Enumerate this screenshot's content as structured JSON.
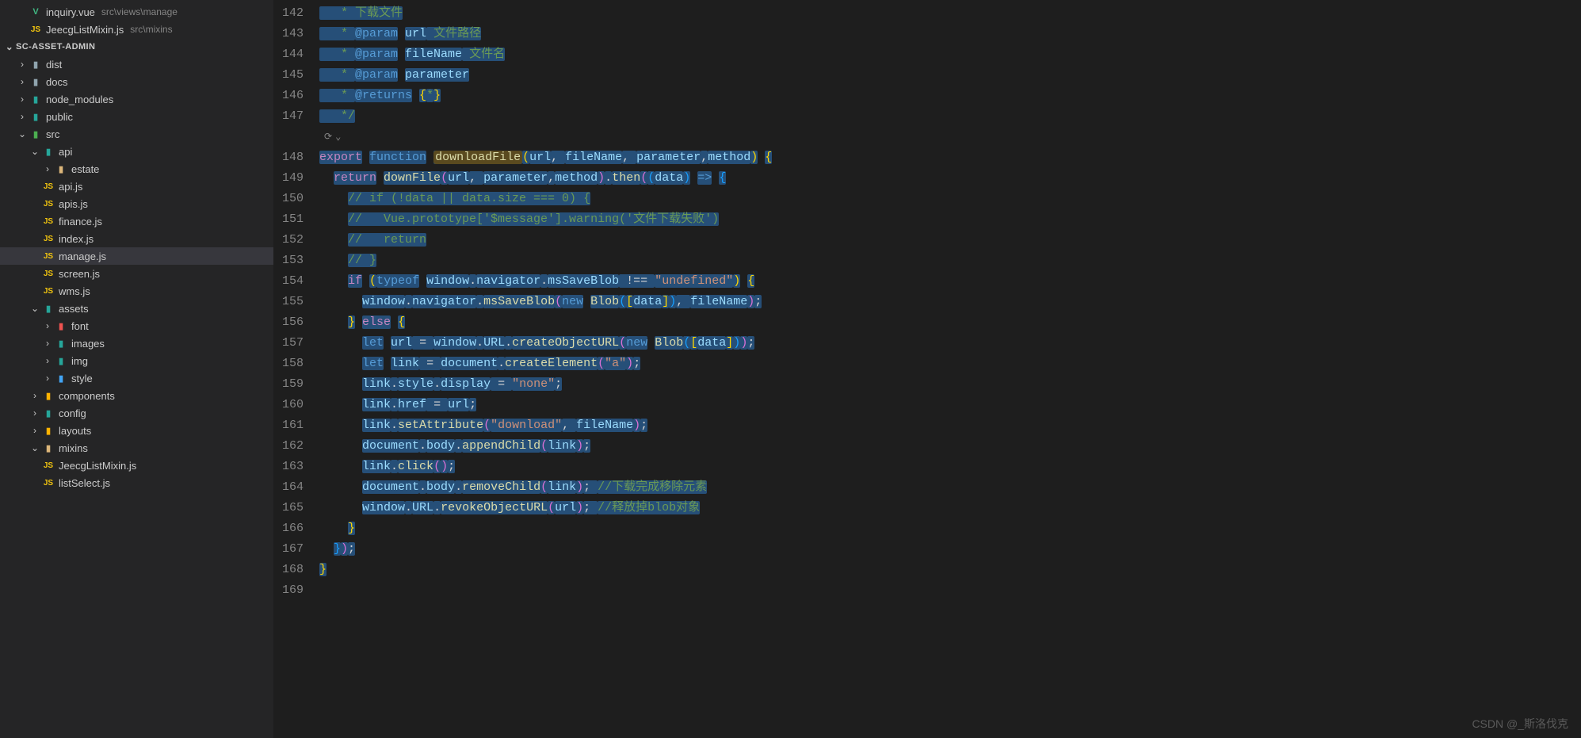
{
  "openEditors": [
    {
      "icon": "V",
      "iconClass": "icon-vue",
      "name": "inquiry.vue",
      "path": "src\\views\\manage"
    },
    {
      "icon": "JS",
      "iconClass": "icon-js",
      "name": "JeecgListMixin.js",
      "path": "src\\mixins"
    }
  ],
  "project": {
    "name": "SC-ASSET-ADMIN"
  },
  "tree": {
    "dist": "dist",
    "docs": "docs",
    "node_modules": "node_modules",
    "public": "public",
    "src": "src",
    "api": "api",
    "estate": "estate",
    "api_js": "api.js",
    "apis_js": "apis.js",
    "finance_js": "finance.js",
    "index_js": "index.js",
    "manage_js": "manage.js",
    "screen_js": "screen.js",
    "wms_js": "wms.js",
    "assets": "assets",
    "font": "font",
    "images": "images",
    "img": "img",
    "style": "style",
    "components": "components",
    "config": "config",
    "layouts": "layouts",
    "mixins": "mixins",
    "jeecg": "JeecgListMixin.js",
    "listSelect": "listSelect.js"
  },
  "codeLines": [
    {
      "num": "142",
      "code": [
        [
          "tok-cmt",
          "   * 下载文件"
        ]
      ]
    },
    {
      "num": "143",
      "code": [
        [
          "tok-cmt",
          "   * "
        ],
        [
          "tok-kw2",
          "@param"
        ],
        [
          "tok-cmt",
          " "
        ],
        [
          "tok-var",
          "url"
        ],
        [
          "tok-cmt",
          " 文件路径"
        ]
      ]
    },
    {
      "num": "144",
      "code": [
        [
          "tok-cmt",
          "   * "
        ],
        [
          "tok-kw2",
          "@param"
        ],
        [
          "tok-cmt",
          " "
        ],
        [
          "tok-var",
          "fileName"
        ],
        [
          "tok-cmt",
          " 文件名"
        ]
      ]
    },
    {
      "num": "145",
      "code": [
        [
          "tok-cmt",
          "   * "
        ],
        [
          "tok-kw2",
          "@param"
        ],
        [
          "tok-cmt",
          " "
        ],
        [
          "tok-var",
          "parameter"
        ]
      ]
    },
    {
      "num": "146",
      "code": [
        [
          "tok-cmt",
          "   * "
        ],
        [
          "tok-kw2",
          "@returns"
        ],
        [
          "tok-cmt",
          " "
        ],
        [
          "tok-brc",
          "{"
        ],
        [
          "tok-cmt",
          "*"
        ],
        [
          "tok-brc",
          "}"
        ]
      ]
    },
    {
      "num": "147",
      "code": [
        [
          "tok-cmt",
          "   */"
        ]
      ]
    }
  ],
  "regionLine": "148",
  "codeLines2": [
    {
      "num": "148",
      "code": [
        [
          "tok-kw",
          "export"
        ],
        [
          "tok-p",
          " "
        ],
        [
          "tok-kw2",
          "function"
        ],
        [
          "tok-p",
          " "
        ],
        [
          "hl-fn",
          "downloadFile"
        ],
        [
          "tok-brc",
          "("
        ],
        [
          "tok-var",
          "url"
        ],
        [
          "tok-p",
          ", "
        ],
        [
          "tok-var",
          "fileName"
        ],
        [
          "tok-p",
          ", "
        ],
        [
          "tok-var",
          "parameter"
        ],
        [
          "tok-p",
          ","
        ],
        [
          "tok-var",
          "method"
        ],
        [
          "tok-brc",
          ")"
        ],
        [
          "tok-p",
          " "
        ],
        [
          "tok-brc",
          "{"
        ]
      ]
    },
    {
      "num": "149",
      "code": [
        [
          "tok-p",
          "  "
        ],
        [
          "tok-kw",
          "return"
        ],
        [
          "tok-p",
          " "
        ],
        [
          "tok-fn",
          "downFile"
        ],
        [
          "tok-brc2",
          "("
        ],
        [
          "tok-var",
          "url"
        ],
        [
          "tok-p",
          ", "
        ],
        [
          "tok-var",
          "parameter"
        ],
        [
          "tok-p",
          ","
        ],
        [
          "tok-var",
          "method"
        ],
        [
          "tok-brc2",
          ")"
        ],
        [
          "tok-p",
          "."
        ],
        [
          "tok-fn",
          "then"
        ],
        [
          "tok-brc2",
          "("
        ],
        [
          "tok-brc3",
          "("
        ],
        [
          "tok-var",
          "data"
        ],
        [
          "tok-brc3",
          ")"
        ],
        [
          "tok-p",
          " "
        ],
        [
          "tok-kw2",
          "=>"
        ],
        [
          "tok-p",
          " "
        ],
        [
          "tok-brc3",
          "{"
        ]
      ]
    },
    {
      "num": "150",
      "code": [
        [
          "tok-p",
          "    "
        ],
        [
          "tok-cmt",
          "// if (!data || data.size === 0) {"
        ]
      ]
    },
    {
      "num": "151",
      "code": [
        [
          "tok-p",
          "    "
        ],
        [
          "tok-cmt",
          "//   Vue.prototype['$message'].warning('文件下载失败')"
        ]
      ]
    },
    {
      "num": "152",
      "code": [
        [
          "tok-p",
          "    "
        ],
        [
          "tok-cmt",
          "//   return"
        ]
      ]
    },
    {
      "num": "153",
      "code": [
        [
          "tok-p",
          "    "
        ],
        [
          "tok-cmt",
          "// }"
        ]
      ]
    },
    {
      "num": "154",
      "code": [
        [
          "tok-p",
          "    "
        ],
        [
          "tok-kw",
          "if"
        ],
        [
          "tok-p",
          " "
        ],
        [
          "tok-brc",
          "("
        ],
        [
          "tok-kw2",
          "typeof"
        ],
        [
          "tok-p",
          " "
        ],
        [
          "tok-var",
          "window"
        ],
        [
          "tok-p",
          "."
        ],
        [
          "tok-var",
          "navigator"
        ],
        [
          "tok-p",
          "."
        ],
        [
          "tok-var",
          "msSaveBlob"
        ],
        [
          "tok-p",
          " !== "
        ],
        [
          "tok-str",
          "\"undefined\""
        ],
        [
          "tok-brc",
          ")"
        ],
        [
          "tok-p",
          " "
        ],
        [
          "tok-brc",
          "{"
        ]
      ]
    },
    {
      "num": "155",
      "code": [
        [
          "tok-p",
          "      "
        ],
        [
          "tok-var",
          "window"
        ],
        [
          "tok-p",
          "."
        ],
        [
          "tok-var",
          "navigator"
        ],
        [
          "tok-p",
          "."
        ],
        [
          "tok-fn",
          "msSaveBlob"
        ],
        [
          "tok-brc2",
          "("
        ],
        [
          "tok-kw2",
          "new"
        ],
        [
          "tok-p",
          " "
        ],
        [
          "tok-fn",
          "Blob"
        ],
        [
          "tok-brc3",
          "("
        ],
        [
          "tok-brc",
          "["
        ],
        [
          "tok-var",
          "data"
        ],
        [
          "tok-brc",
          "]"
        ],
        [
          "tok-brc3",
          ")"
        ],
        [
          "tok-p",
          ", "
        ],
        [
          "tok-var",
          "fileName"
        ],
        [
          "tok-brc2",
          ")"
        ],
        [
          "tok-p",
          ";"
        ]
      ]
    },
    {
      "num": "156",
      "code": [
        [
          "tok-p",
          "    "
        ],
        [
          "tok-brc",
          "}"
        ],
        [
          "tok-p",
          " "
        ],
        [
          "tok-kw",
          "else"
        ],
        [
          "tok-p",
          " "
        ],
        [
          "tok-brc",
          "{"
        ]
      ]
    },
    {
      "num": "157",
      "code": [
        [
          "tok-p",
          "      "
        ],
        [
          "tok-kw2",
          "let"
        ],
        [
          "tok-p",
          " "
        ],
        [
          "tok-var",
          "url"
        ],
        [
          "tok-p",
          " = "
        ],
        [
          "tok-var",
          "window"
        ],
        [
          "tok-p",
          "."
        ],
        [
          "tok-var",
          "URL"
        ],
        [
          "tok-p",
          "."
        ],
        [
          "tok-fn",
          "createObjectURL"
        ],
        [
          "tok-brc2",
          "("
        ],
        [
          "tok-kw2",
          "new"
        ],
        [
          "tok-p",
          " "
        ],
        [
          "tok-fn",
          "Blob"
        ],
        [
          "tok-brc3",
          "("
        ],
        [
          "tok-brc",
          "["
        ],
        [
          "tok-var",
          "data"
        ],
        [
          "tok-brc",
          "]"
        ],
        [
          "tok-brc3",
          ")"
        ],
        [
          "tok-brc2",
          ")"
        ],
        [
          "tok-p",
          ";"
        ]
      ]
    },
    {
      "num": "158",
      "code": [
        [
          "tok-p",
          "      "
        ],
        [
          "tok-kw2",
          "let"
        ],
        [
          "tok-p",
          " "
        ],
        [
          "tok-var",
          "link"
        ],
        [
          "tok-p",
          " = "
        ],
        [
          "tok-var",
          "document"
        ],
        [
          "tok-p",
          "."
        ],
        [
          "tok-fn",
          "createElement"
        ],
        [
          "tok-brc2",
          "("
        ],
        [
          "tok-str",
          "\"a\""
        ],
        [
          "tok-brc2",
          ")"
        ],
        [
          "tok-p",
          ";"
        ]
      ]
    },
    {
      "num": "159",
      "code": [
        [
          "tok-p",
          "      "
        ],
        [
          "tok-var",
          "link"
        ],
        [
          "tok-p",
          "."
        ],
        [
          "tok-var",
          "style"
        ],
        [
          "tok-p",
          "."
        ],
        [
          "tok-var",
          "display"
        ],
        [
          "tok-p",
          " = "
        ],
        [
          "tok-str",
          "\"none\""
        ],
        [
          "tok-p",
          ";"
        ]
      ]
    },
    {
      "num": "160",
      "code": [
        [
          "tok-p",
          "      "
        ],
        [
          "tok-var",
          "link"
        ],
        [
          "tok-p",
          "."
        ],
        [
          "tok-var",
          "href"
        ],
        [
          "tok-p",
          " = "
        ],
        [
          "tok-var",
          "url"
        ],
        [
          "tok-p",
          ";"
        ]
      ]
    },
    {
      "num": "161",
      "code": [
        [
          "tok-p",
          "      "
        ],
        [
          "tok-var",
          "link"
        ],
        [
          "tok-p",
          "."
        ],
        [
          "tok-fn",
          "setAttribute"
        ],
        [
          "tok-brc2",
          "("
        ],
        [
          "tok-str",
          "\"download\""
        ],
        [
          "tok-p",
          ", "
        ],
        [
          "tok-var",
          "fileName"
        ],
        [
          "tok-brc2",
          ")"
        ],
        [
          "tok-p",
          ";"
        ]
      ]
    },
    {
      "num": "162",
      "code": [
        [
          "tok-p",
          "      "
        ],
        [
          "tok-var",
          "document"
        ],
        [
          "tok-p",
          "."
        ],
        [
          "tok-var",
          "body"
        ],
        [
          "tok-p",
          "."
        ],
        [
          "tok-fn",
          "appendChild"
        ],
        [
          "tok-brc2",
          "("
        ],
        [
          "tok-var",
          "link"
        ],
        [
          "tok-brc2",
          ")"
        ],
        [
          "tok-p",
          ";"
        ]
      ]
    },
    {
      "num": "163",
      "code": [
        [
          "tok-p",
          "      "
        ],
        [
          "tok-var",
          "link"
        ],
        [
          "tok-p",
          "."
        ],
        [
          "tok-fn",
          "click"
        ],
        [
          "tok-brc2",
          "("
        ],
        [
          "tok-brc2",
          ")"
        ],
        [
          "tok-p",
          ";"
        ]
      ]
    },
    {
      "num": "164",
      "code": [
        [
          "tok-p",
          "      "
        ],
        [
          "tok-var",
          "document"
        ],
        [
          "tok-p",
          "."
        ],
        [
          "tok-var",
          "body"
        ],
        [
          "tok-p",
          "."
        ],
        [
          "tok-fn",
          "removeChild"
        ],
        [
          "tok-brc2",
          "("
        ],
        [
          "tok-var",
          "link"
        ],
        [
          "tok-brc2",
          ")"
        ],
        [
          "tok-p",
          "; "
        ],
        [
          "tok-cmt",
          "//下载完成移除元素"
        ]
      ]
    },
    {
      "num": "165",
      "code": [
        [
          "tok-p",
          "      "
        ],
        [
          "tok-var",
          "window"
        ],
        [
          "tok-p",
          "."
        ],
        [
          "tok-var",
          "URL"
        ],
        [
          "tok-p",
          "."
        ],
        [
          "tok-fn",
          "revokeObjectURL"
        ],
        [
          "tok-brc2",
          "("
        ],
        [
          "tok-var",
          "url"
        ],
        [
          "tok-brc2",
          ")"
        ],
        [
          "tok-p",
          "; "
        ],
        [
          "tok-cmt",
          "//释放掉blob对象"
        ]
      ]
    },
    {
      "num": "166",
      "code": [
        [
          "tok-p",
          "    "
        ],
        [
          "tok-brc",
          "}"
        ]
      ]
    },
    {
      "num": "167",
      "code": [
        [
          "tok-p",
          "  "
        ],
        [
          "tok-brc3",
          "}"
        ],
        [
          "tok-brc2",
          ")"
        ],
        [
          "tok-p",
          ";"
        ]
      ]
    },
    {
      "num": "168",
      "code": [
        [
          "tok-brc",
          "}"
        ]
      ]
    },
    {
      "num": "169",
      "code": [
        [
          "tok-p",
          ""
        ]
      ]
    }
  ],
  "watermark": "CSDN @_斯洛伐克"
}
